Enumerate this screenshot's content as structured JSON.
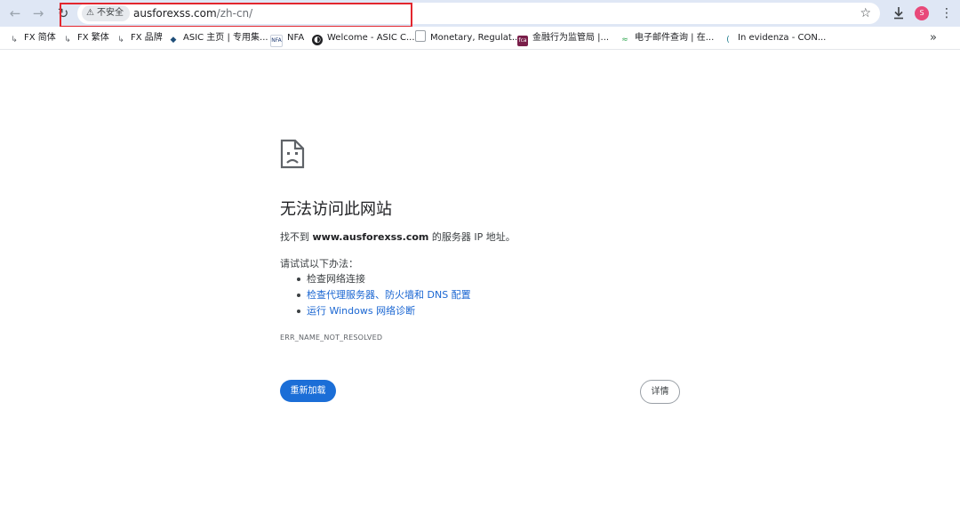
{
  "browser": {
    "security_chip": "不安全",
    "url_host": "ausforexss.com",
    "url_path": "/zh-cn/",
    "profile_initial": "S"
  },
  "bookmarks": [
    {
      "label": "FX 简体",
      "icon": "fx-link-icon"
    },
    {
      "label": "FX 繁体",
      "icon": "fx-link-icon"
    },
    {
      "label": "FX 品牌",
      "icon": "fx-link-icon"
    },
    {
      "label": "ASIC 主页 | 专用集...",
      "icon": "asic-diamond-icon"
    },
    {
      "label": "NFA",
      "icon": "nfa-logo-icon"
    },
    {
      "label": "Welcome - ASIC C...",
      "icon": "globe-icon"
    },
    {
      "label": "Monetary, Regulat...",
      "icon": "page-icon"
    },
    {
      "label": "金融行为监管局 |...",
      "icon": "fca-logo-icon"
    },
    {
      "label": "电子邮件查询 | 在...",
      "icon": "wifi-signal-icon"
    },
    {
      "label": "In evidenza - CON...",
      "icon": "consob-logo-icon"
    }
  ],
  "error": {
    "title": "无法访问此网站",
    "desc_prefix": "找不到 ",
    "desc_host": "www.ausforexss.com",
    "desc_suffix": " 的服务器 IP 地址。",
    "suggest_heading": "请试试以下办法：",
    "suggestions": [
      "检查网络连接",
      "检查代理服务器、防火墙和 DNS 配置",
      "运行 Windows 网络诊断"
    ],
    "code": "ERR_NAME_NOT_RESOLVED",
    "reload_label": "重新加载",
    "details_label": "详情"
  },
  "colors": {
    "accent": "#1b6ed7",
    "link": "#1a66d2",
    "highlight_box": "#e3262e",
    "toolbar_bg": "#dfe7f5"
  }
}
